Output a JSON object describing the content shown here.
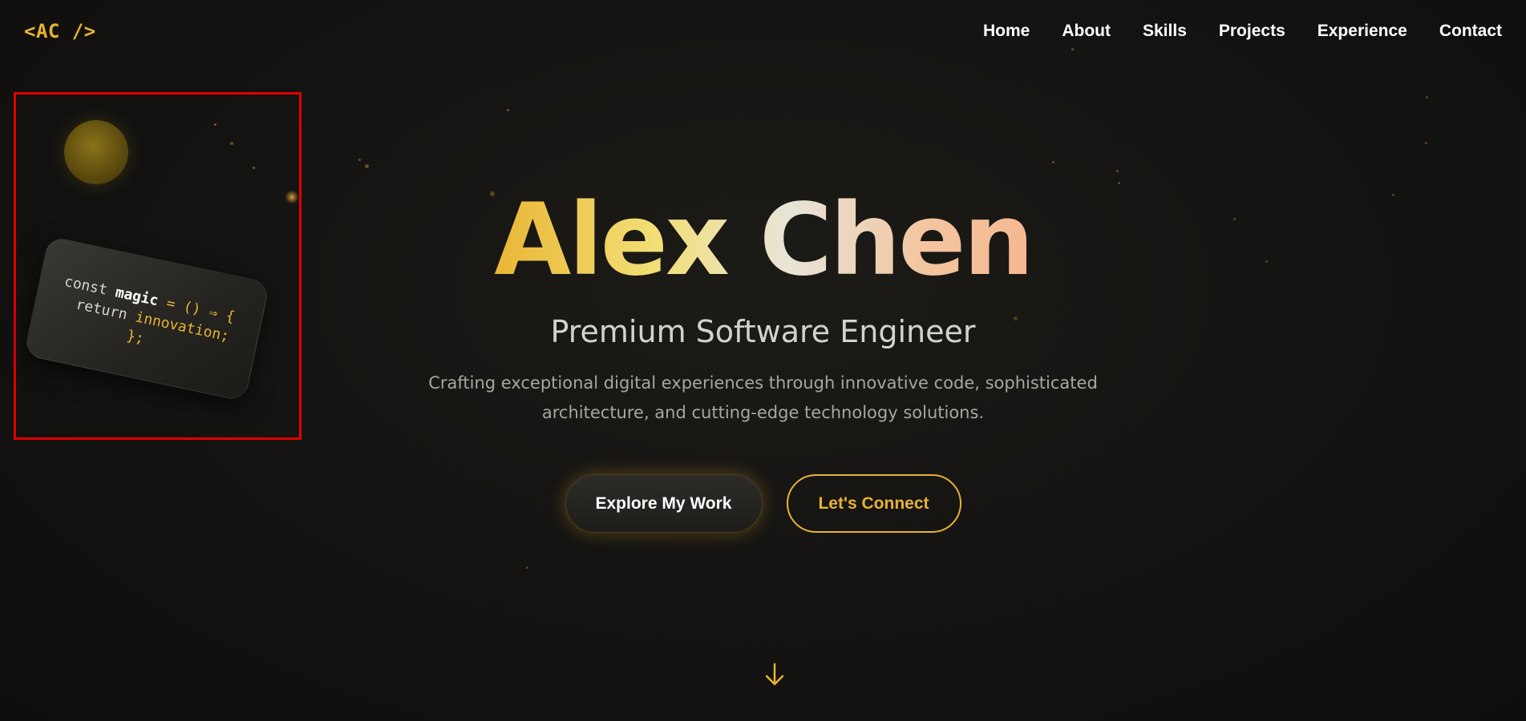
{
  "header": {
    "logo": "<AC />",
    "nav": [
      {
        "label": "Home"
      },
      {
        "label": "About"
      },
      {
        "label": "Skills"
      },
      {
        "label": "Projects"
      },
      {
        "label": "Experience"
      },
      {
        "label": "Contact"
      }
    ]
  },
  "code_card": {
    "line1_kw": "const",
    "line1_name": "magic",
    "line1_rest": "= () ⇒ {",
    "line2_kw": "return",
    "line2_val": "innovation;",
    "line3": "};"
  },
  "hero": {
    "name": "Alex Chen",
    "subtitle": "Premium Software Engineer",
    "description": "Crafting exceptional digital experiences through innovative code, sophisticated architecture, and cutting-edge technology solutions.",
    "primary_button": "Explore My Work",
    "secondary_button": "Let's Connect"
  },
  "icons": {
    "scroll": "arrow-down-icon"
  },
  "colors": {
    "accent": "#e6b433",
    "background": "#151412",
    "highlight_border": "#e00000"
  }
}
